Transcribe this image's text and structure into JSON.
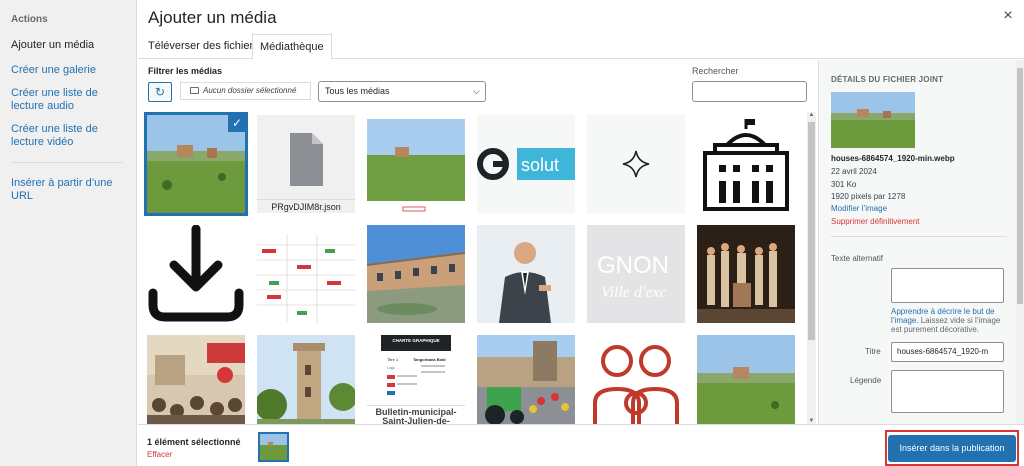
{
  "menu": {
    "heading": "Actions",
    "items": [
      {
        "label": "Ajouter un média"
      },
      {
        "label": "Créer une galerie"
      },
      {
        "label": "Créer une liste de lecture audio"
      },
      {
        "label": "Créer une liste de lecture vidéo"
      },
      {
        "label": "Insérer à partir d’une URL"
      }
    ]
  },
  "header": {
    "title": "Ajouter un média",
    "close": "×",
    "tabs": [
      {
        "label": "Téléverser des fichiers"
      },
      {
        "label": "Médiathèque"
      }
    ]
  },
  "toolbar": {
    "filter_label": "Filtrer les médias",
    "refresh": "↻",
    "folder": "Aucun dossier sélectionné",
    "type": "Tous les médias",
    "search_label": "Rechercher"
  },
  "grid": {
    "file_label": "PRgvDJIM8r.json",
    "pdf_label": "Bulletin-municipal-Saint-Julien-de-Cassagnas-",
    "text_fragment": "solut",
    "text_fragment2": "GNON",
    "text_fragment3": "Ville d'exc",
    "charte_title": "CHARTE GRAPHIQUE",
    "charte_sub1": "Titre 1",
    "charte_sub2": "Tangorbana Bold",
    "charte_logo": "Logo"
  },
  "details": {
    "title": "DÉTAILS DU FICHIER JOINT",
    "filename": "houses-6864574_1920-min.webp",
    "date": "22 avril 2024",
    "size": "301 Ko",
    "dimensions": "1920 pixels par 1278",
    "edit_link": "Modifier l’image",
    "delete_link": "Supprimer définitivement",
    "alt_label": "Texte alternatif",
    "help_link": "Apprendre à décrire le but de l’image",
    "help_text": ". Laissez vide si l’image est purement décorative.",
    "title_label": "Titre",
    "title_value": "houses-6864574_1920-m",
    "caption_label": "Légende"
  },
  "footer": {
    "selected": "1 élément sélectionné",
    "clear": "Effacer",
    "insert": "Insérer dans la publication"
  },
  "colors": {
    "accent": "#2271b1",
    "danger": "#d63638"
  }
}
